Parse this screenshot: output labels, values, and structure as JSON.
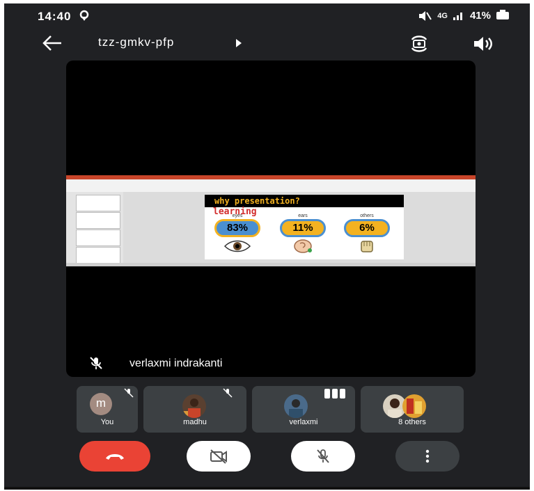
{
  "status_bar": {
    "time": "14:40",
    "signal_text": "4G",
    "battery": "41%"
  },
  "header": {
    "meeting_code": "tzz-gmkv-pfp",
    "icons": [
      "back-arrow-icon",
      "play-arrow-icon",
      "switch-camera-icon",
      "speaker-icon"
    ]
  },
  "main_tile": {
    "participant_name": "verlaxmi indrakanti",
    "muted": true,
    "presentation": {
      "title": "why presentation?",
      "subtitle": "learning",
      "columns": [
        {
          "label": "eyes",
          "value": "83%",
          "color": "#4a8fd1"
        },
        {
          "label": "ears",
          "value": "11%",
          "color": "#f3b221"
        },
        {
          "label": "others",
          "value": "6%",
          "color": "#f3b221"
        }
      ]
    }
  },
  "participants": [
    {
      "name": "You",
      "avatar_letter": "m",
      "muted": true
    },
    {
      "name": "madhu",
      "muted": true
    },
    {
      "name": "verlaxmi",
      "speaking": true
    },
    {
      "name": "8 others"
    }
  ],
  "controls": {
    "end_call_color": "#ea4335",
    "icons": [
      "hang-up-icon",
      "camera-off-icon",
      "mic-off-icon",
      "more-vert-icon"
    ]
  },
  "colors": {
    "background": "#202124",
    "tile": "#3c4043",
    "accent_red": "#ea4335"
  }
}
